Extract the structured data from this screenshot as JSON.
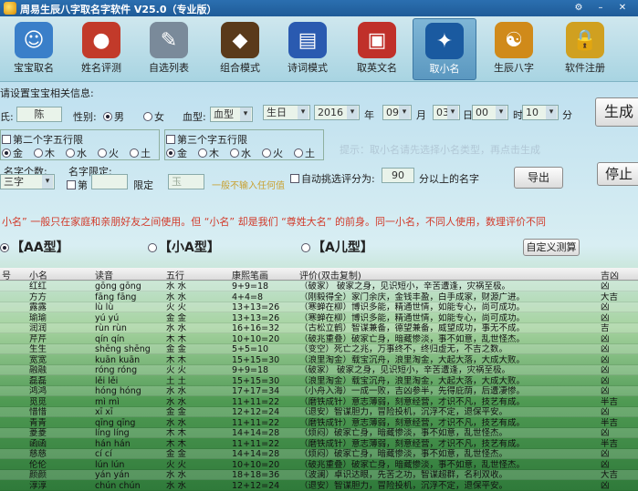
{
  "window": {
    "title": "周易生辰八字取名字软件 V25.0（专业版）"
  },
  "toolbar": [
    {
      "label": "宝宝取名",
      "icon": "baby-icon",
      "color": "#3a7fc9"
    },
    {
      "label": "姓名评测",
      "icon": "globe-icon",
      "color": "#c23a2a"
    },
    {
      "label": "自选列表",
      "icon": "brush-pot-icon",
      "color": "#7a8a9a"
    },
    {
      "label": "组合模式",
      "icon": "dragon-icon",
      "color": "#5a3a1a"
    },
    {
      "label": "诗词模式",
      "icon": "book-icon",
      "color": "#2a5ab0"
    },
    {
      "label": "取英文名",
      "icon": "badge-icon",
      "color": "#c0302a"
    },
    {
      "label": "取小名",
      "icon": "bird-icon",
      "color": "#1a5aa0"
    },
    {
      "label": "生辰八字",
      "icon": "bagua-icon",
      "color": "#d08a1a"
    },
    {
      "label": "软件注册",
      "icon": "lock-icon",
      "color": "#d0a020"
    }
  ],
  "form": {
    "section_label": "请设置宝宝相关信息:",
    "surname_label": "氏:",
    "surname_value": "陈",
    "gender_label": "性别:",
    "gender_male": "男",
    "gender_female": "女",
    "blood_label": "血型:",
    "blood_value": "血型",
    "calendar_value": "生日",
    "year_value": "2016",
    "year_label": "年",
    "month_value": "09",
    "month_label": "月",
    "day_value": "03",
    "day_label": "日",
    "hour_value": "00",
    "hour_label": "时",
    "minute_value": "10",
    "minute_label": "分",
    "generate_button": "生成",
    "stop_button": "停止",
    "export_button": "导出",
    "second_wuxing_label": "第二个字五行限",
    "third_wuxing_label": "第三个字五行限",
    "wuxing_options": [
      "金",
      "木",
      "水",
      "火",
      "土"
    ],
    "name_count_label": "名字个数:",
    "name_count_value": "三字",
    "name_limit_label": "名字限定:",
    "limit_prefix": "第",
    "limit_suffix": "限定",
    "limit_char": "玉",
    "limit_hint": "一般不输入任何值",
    "auto_pick_label": "自动挑选评分为:",
    "auto_pick_value": "90",
    "auto_pick_suffix": "分以上的名字",
    "faint_notice": "提示：取小名请先选择小名类型，再点击生成",
    "warning_text": "小名” 一般只在家庭和亲朋好友之间使用。但 “小名” 却是我们 “尊姓大名” 的前身。同一小名，不同人使用，数理评价不同",
    "type_aa": "【AA型】",
    "type_xa": "【小A型】",
    "type_aer": "【A儿型】",
    "custom_button": "自定义测算"
  },
  "table": {
    "headers": [
      "号",
      "小名",
      "读音",
      "五行",
      "康熙笔画",
      "评价(双击复制)",
      "吉凶"
    ],
    "rows": [
      [
        "",
        "红红",
        "gōng gōng",
        "水 水",
        "9+9=18",
        "（破家） 破家之身，见识短小，辛苦遭逢，灾祸至极。",
        "凶"
      ],
      [
        "",
        "方方",
        "fāng fāng",
        "水 水",
        "4+4=8",
        "（刚毅得全）家门余庆，金钱丰盈，白手成家，财源广进。",
        "大吉"
      ],
      [
        "",
        "露露",
        "lù lù",
        "火 火",
        "13+13=26",
        "（寒蝉在柳）博识多能，精通世情，如能专心，尚可成功。",
        "凶"
      ],
      [
        "",
        "瑜瑜",
        "yú yú",
        "金 金",
        "13+13=26",
        "（寒蝉在柳）博识多能，精通世情，如能专心，尚可成功。",
        "凶"
      ],
      [
        "",
        "润润",
        "rùn rùn",
        "水 水",
        "16+16=32",
        "（古松立鹤）智谋兼备，德望兼备，威望成功，事无不成。",
        "吉"
      ],
      [
        "",
        "芹芹",
        "qín qín",
        "木 木",
        "10+10=20",
        "（破兆重叠）破家亡身，暗藏惨淡，事不如意，乱世怪杰。",
        "凶"
      ],
      [
        "",
        "生生",
        "shēng shēng",
        "金 金",
        "5+5=10",
        "（变空）死亡之兆，万事终不，终归虚无，不吉之数。",
        "凶"
      ],
      [
        "",
        "宽宽",
        "kuān kuān",
        "木 木",
        "15+15=30",
        "（浪里淘金）载宝沉舟，浪里淘金，大起大落，大成大败。",
        "凶"
      ],
      [
        "",
        "融融",
        "róng róng",
        "火 火",
        "9+9=18",
        "（破家） 破家之身，见识短小，辛苦遭逢，灾祸至极。",
        "凶"
      ],
      [
        "",
        "磊磊",
        "lěi lěi",
        "土 土",
        "15+15=30",
        "（浪里淘金）载宝沉舟，浪里淘金，大起大落，大成大败。",
        "凶"
      ],
      [
        "",
        "鸿鸿",
        "hóng hóng",
        "水 水",
        "17+17=34",
        "（小舟入海）一成一败，吉凶参半，先得庇荫，后遭凄惨。",
        "凶"
      ],
      [
        "",
        "觅觅",
        "mì mì",
        "水 水",
        "11+11=22",
        "（磨铁成针）意志薄弱，刻意经营，才识不凡，技艺有成。",
        "半吉"
      ],
      [
        "",
        "惜惜",
        "xī xī",
        "金 金",
        "12+12=24",
        "（退安）智谋胆力，冒险投机，沉浮不定，退保平安。",
        "凶"
      ],
      [
        "",
        "青青",
        "qīng qīng",
        "水 水",
        "11+11=22",
        "（磨铁成针）意志薄弱，刻意经营，才识不凡，技艺有成。",
        "半吉"
      ],
      [
        "",
        "菱菱",
        "líng líng",
        "木 木",
        "14+14=28",
        "（烦闷）破家亡身，暗藏惨淡，事不如意，乱世怪杰。",
        "凶"
      ],
      [
        "",
        "函函",
        "hán hán",
        "木 木",
        "11+11=22",
        "（磨铁成针）意志薄弱，刻意经营，才识不凡，技艺有成。",
        "半吉"
      ],
      [
        "",
        "慈慈",
        "cí cí",
        "金 金",
        "14+14=28",
        "（烦闷）破家亡身，暗藏惨淡，事不如意，乱世怪杰。",
        "凶"
      ],
      [
        "",
        "伦伦",
        "lún lún",
        "火 火",
        "10+10=20",
        "（破兆重叠）破家亡身，暗藏惨淡，事不如意，乱世怪杰。",
        "凶"
      ],
      [
        "",
        "颜颜",
        "yán yán",
        "水 水",
        "18+18=36",
        "（波澜）卓识达眼，先苦之功，智谋超群，名利双收。",
        "大吉"
      ],
      [
        "",
        "淳淳",
        "chún chún",
        "水 水",
        "12+12=24",
        "（退安）智谋胆力，冒险投机，沉浮不定，退保平安。",
        "凶"
      ]
    ]
  }
}
